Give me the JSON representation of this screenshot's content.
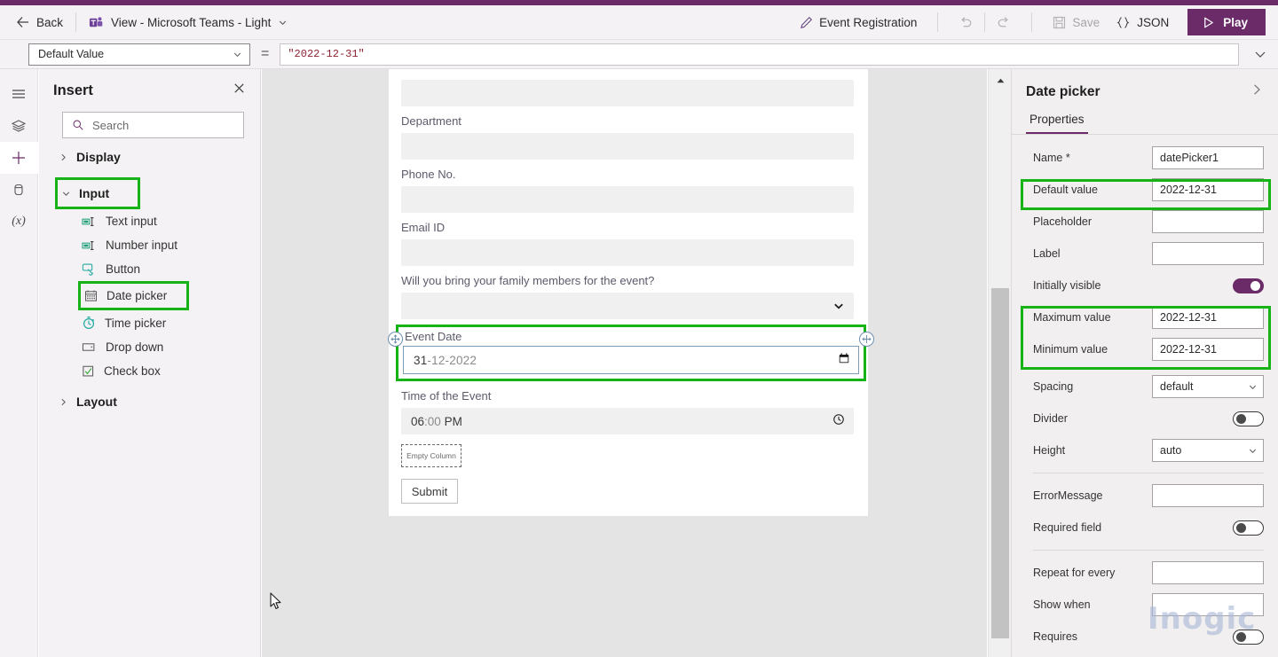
{
  "theme": {
    "accent": "#6b2a68",
    "highlight": "#16b316",
    "canvas_bg": "#e4e4e4"
  },
  "commandbar": {
    "back_label": "Back",
    "doc_title": "View - Microsoft Teams - Light",
    "edit_label": "Event Registration",
    "undo_label": "undo-icon",
    "redo_label": "redo-icon",
    "save_label": "Save",
    "json_label": "JSON",
    "play_label": "Play"
  },
  "formulabar": {
    "property_selected": "Default Value",
    "equals": "=",
    "formula": "\"2022-12-31\""
  },
  "rail": {
    "items": [
      {
        "name": "hamburger-icon"
      },
      {
        "name": "layers-icon"
      },
      {
        "name": "add-icon"
      },
      {
        "name": "data-icon"
      },
      {
        "name": "variables-icon",
        "label": "(x)"
      }
    ]
  },
  "insert": {
    "title": "Insert",
    "close_label": "×",
    "search_placeholder": "Search",
    "groups": [
      {
        "label": "Display",
        "expanded": false,
        "highlighted": false
      },
      {
        "label": "Input",
        "expanded": true,
        "highlighted": true
      },
      {
        "label": "Layout",
        "expanded": false,
        "highlighted": false
      }
    ],
    "input_items": [
      {
        "label": "Text input",
        "icon": "text-input-icon",
        "highlighted": false
      },
      {
        "label": "Number input",
        "icon": "number-input-icon",
        "highlighted": false
      },
      {
        "label": "Button",
        "icon": "button-icon",
        "highlighted": false
      },
      {
        "label": "Date picker",
        "icon": "calendar-icon",
        "highlighted": true
      },
      {
        "label": "Time picker",
        "icon": "clock-icon",
        "highlighted": false
      },
      {
        "label": "Drop down",
        "icon": "dropdown-icon",
        "highlighted": false
      },
      {
        "label": "Check box",
        "icon": "checkbox-icon",
        "highlighted": false
      }
    ]
  },
  "canvas": {
    "fields": [
      {
        "type": "input",
        "label": "",
        "value": ""
      },
      {
        "type": "label",
        "label": "Department"
      },
      {
        "type": "input",
        "label": "",
        "value": ""
      },
      {
        "type": "label",
        "label": "Phone No."
      },
      {
        "type": "input",
        "label": "",
        "value": ""
      },
      {
        "type": "label",
        "label": "Email ID"
      },
      {
        "type": "input",
        "label": "",
        "value": ""
      },
      {
        "type": "label",
        "label": "Will you bring your family members for the event?"
      }
    ],
    "dropdown_value": "",
    "selected_component": {
      "label": "Event Date",
      "date_day": "31",
      "date_sep1": "-",
      "date_month": "12",
      "date_sep2": "-",
      "date_year": "2022",
      "icon": "calendar-icon"
    },
    "time_field": {
      "label": "Time of the Event",
      "time_hour": "06",
      "time_sep": ":",
      "time_min": "00",
      "time_ampm": "PM",
      "icon": "clock-icon"
    },
    "empty_column_label": "Empty Column",
    "submit_label": "Submit"
  },
  "properties": {
    "title": "Date picker",
    "tab": "Properties",
    "rows": [
      {
        "label": "Name *",
        "type": "text",
        "value": "datePicker1",
        "highlighted": false
      },
      {
        "label": "Default value",
        "type": "text",
        "value": "2022-12-31",
        "highlighted": true
      },
      {
        "label": "Placeholder",
        "type": "text",
        "value": "",
        "highlighted": false
      },
      {
        "label": "Label",
        "type": "text",
        "value": "",
        "highlighted": false
      },
      {
        "label": "Initially visible",
        "type": "toggle",
        "value": "on",
        "highlighted": false
      },
      {
        "label": "Maximum value",
        "type": "text",
        "value": "2022-12-31",
        "highlighted": true
      },
      {
        "label": "Minimum value",
        "type": "text",
        "value": "2022-12-31",
        "highlighted": true
      },
      {
        "label": "Spacing",
        "type": "select",
        "value": "default",
        "highlighted": false
      },
      {
        "label": "Divider",
        "type": "toggle",
        "value": "off",
        "highlighted": false
      },
      {
        "label": "Height",
        "type": "select",
        "value": "auto",
        "highlighted": false
      },
      {
        "label": "ErrorMessage",
        "type": "text",
        "value": "",
        "highlighted": false
      },
      {
        "label": "Required field",
        "type": "toggle",
        "value": "off",
        "highlighted": false
      },
      {
        "label": "Repeat for every",
        "type": "text",
        "value": "",
        "highlighted": false
      },
      {
        "label": "Show when",
        "type": "text",
        "value": "",
        "highlighted": false
      },
      {
        "label": "Requires",
        "type": "toggle",
        "value": "off",
        "highlighted": false
      }
    ]
  },
  "watermark": {
    "text": "Inogic"
  }
}
